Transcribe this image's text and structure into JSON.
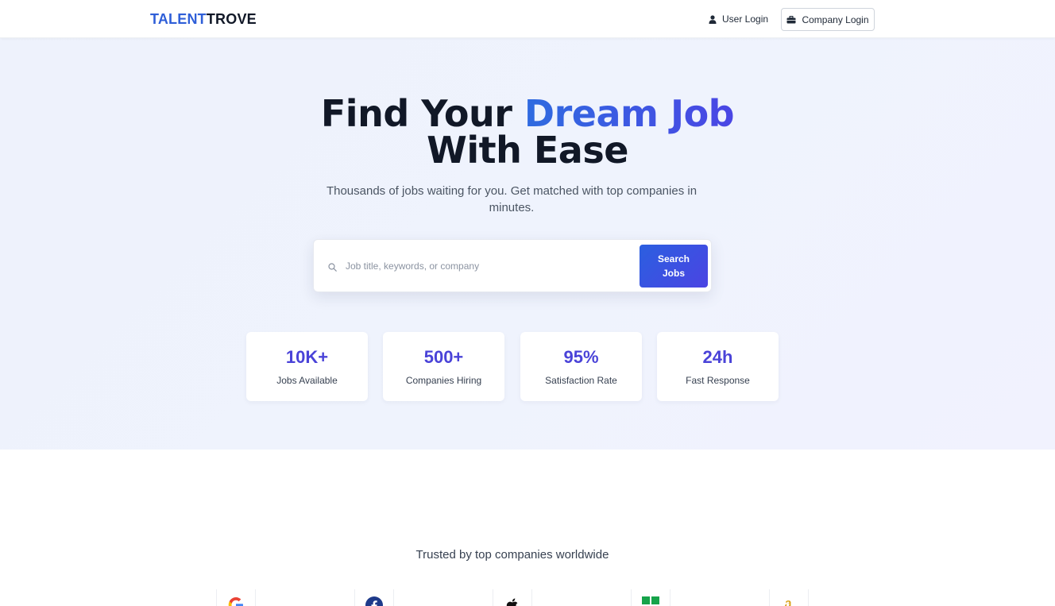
{
  "header": {
    "logo_part1": "TALENT",
    "logo_part2": "TROVE",
    "user_login_label": "User Login",
    "company_login_label": "Company Login"
  },
  "hero": {
    "title_line1_plain": "Find Your ",
    "title_line1_accent": "Dream Job",
    "title_line2": "With Ease",
    "subtitle": "Thousands of jobs waiting for you. Get matched with top companies in minutes.",
    "search": {
      "placeholder": "Job title, keywords, or company",
      "button_label": "Search Jobs"
    },
    "stats": [
      {
        "value": "10K+",
        "label": "Jobs Available"
      },
      {
        "value": "500+",
        "label": "Companies Hiring"
      },
      {
        "value": "95%",
        "label": "Satisfaction Rate"
      },
      {
        "value": "24h",
        "label": "Fast Response"
      }
    ]
  },
  "trusted": {
    "title": "Trusted by top companies worldwide",
    "logos": [
      {
        "icon": "google-icon",
        "color": "#4285f4"
      },
      {
        "icon": "facebook-icon",
        "color": "#1e3a8a"
      },
      {
        "icon": "apple-icon",
        "color": "#111111"
      },
      {
        "icon": "microsoft-icon",
        "color": "#16a34a"
      },
      {
        "icon": "amazon-icon",
        "color": "#d9a016"
      }
    ]
  },
  "colors": {
    "brand": "#2f5fd8",
    "accent": "#4a43d8",
    "hero_bg": "#eef2fc"
  }
}
